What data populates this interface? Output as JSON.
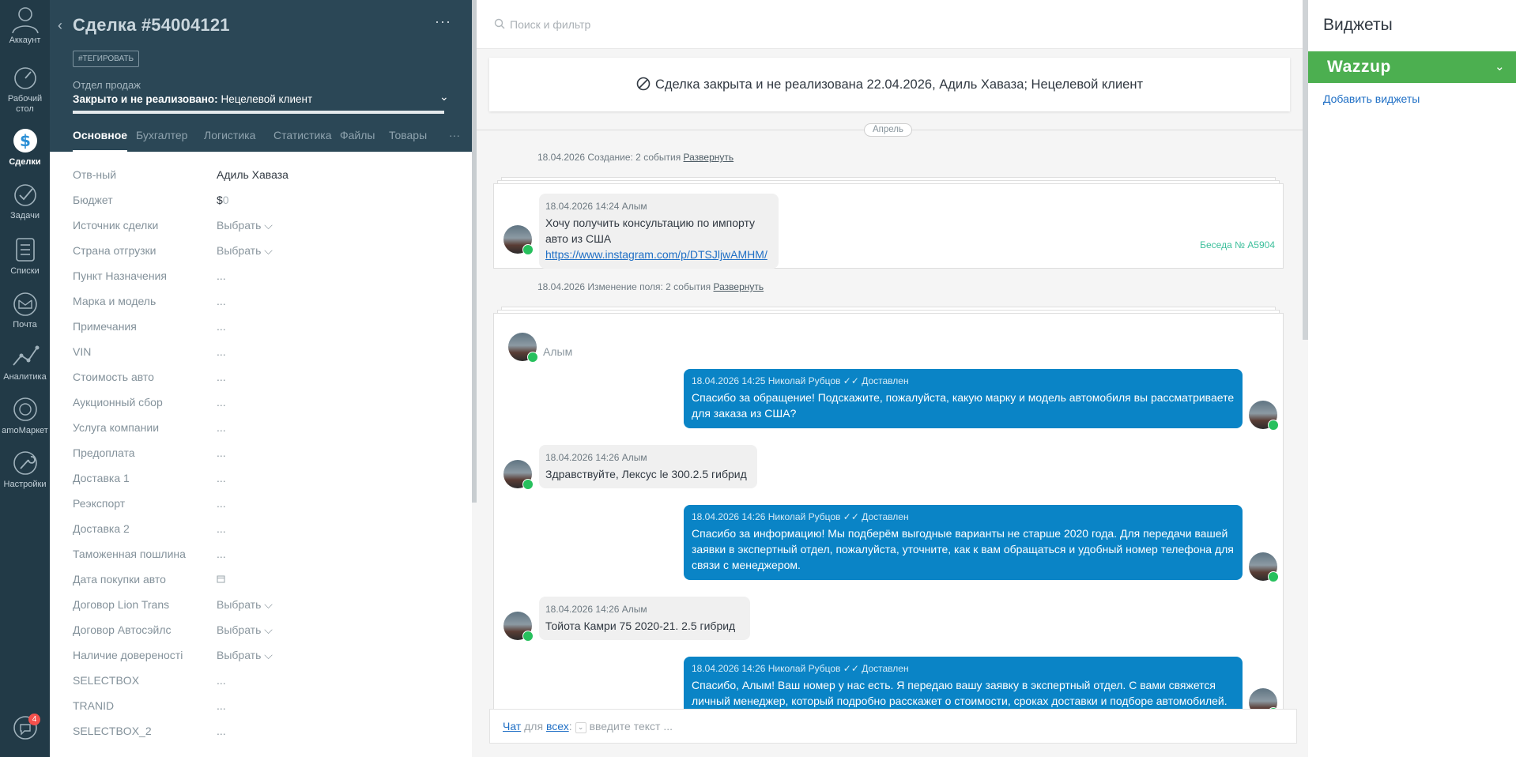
{
  "nav": {
    "account": "Аккаунт",
    "dashboard": "Рабочий стол",
    "deals": "Сделки",
    "tasks": "Задачи",
    "lists": "Списки",
    "mail": "Почта",
    "analytics": "Аналитика",
    "market": "amoМаркет",
    "settings": "Настройки",
    "notifications_count": "4"
  },
  "card": {
    "title": "Сделка #54004121",
    "more": "···",
    "tag_button": "#ТЕГИРОВАТЬ",
    "pipeline_name": "Отдел продаж",
    "status_bold": "Закрыто и не реализовано:",
    "status_reason": " Нецелевой клиент",
    "tabs": [
      "Основное",
      "Бухгалтер",
      "Логистика",
      "Статистика",
      "Файлы",
      "Товары"
    ],
    "tabs_more": "···",
    "fields": [
      {
        "label": "Отв-ный",
        "value": "Адиль Хаваза"
      },
      {
        "label": "Бюджет",
        "value": ""
      },
      {
        "label": "Источник сделки",
        "value": "Выбрать"
      },
      {
        "label": "Страна отгрузки",
        "value": "Выбрать"
      },
      {
        "label": "Пункт Назначения",
        "value": "..."
      },
      {
        "label": "Марка и модель",
        "value": "..."
      },
      {
        "label": "Примечания",
        "value": "..."
      },
      {
        "label": "VIN",
        "value": "..."
      },
      {
        "label": "Стоимость авто",
        "value": "..."
      },
      {
        "label": "Аукционный сбор",
        "value": "..."
      },
      {
        "label": "Услуга компании",
        "value": "..."
      },
      {
        "label": "Предоплата",
        "value": "..."
      },
      {
        "label": "Доставка 1",
        "value": "..."
      },
      {
        "label": "Реэкспорт",
        "value": "..."
      },
      {
        "label": "Доставка 2",
        "value": "..."
      },
      {
        "label": "Таможенная пошлина",
        "value": "..."
      },
      {
        "label": "Дата покупки авто",
        "value": ""
      },
      {
        "label": "Договор Lion Trans",
        "value": "Выбрать"
      },
      {
        "label": "Договор Автосэйлс",
        "value": "Выбрать"
      },
      {
        "label": "Наличие довереностi",
        "value": "Выбрать"
      },
      {
        "label": "SELECTBOX",
        "value": "..."
      },
      {
        "label": "TRANID",
        "value": "..."
      },
      {
        "label": "SELECTBOX_2",
        "value": "..."
      }
    ],
    "budget_currency": "$",
    "budget_value": "0"
  },
  "feed": {
    "search_placeholder": "Поиск и фильтр",
    "closed_banner": "Сделка закрыта и не реализована 22.04.2026, Адиль Хаваза; Нецелевой клиент",
    "month": "Апрель",
    "group1": {
      "text": "18.04.2026 Создание: 2 события ",
      "link": "Развернуть"
    },
    "group2": {
      "text": "18.04.2026 Изменение поля: 2 события ",
      "link": "Развернуть"
    },
    "first_msg": {
      "meta": "18.04.2026 14:24 Алым",
      "text": "Хочу получить консультацию по импорту авто из США",
      "link": "https://www.instagram.com/p/DTSJljwAMHM/",
      "talk": "Беседа № A5904"
    },
    "chat": {
      "sender": "Алым",
      "messages": [
        {
          "dir": "out",
          "meta": "18.04.2026 14:25 Николай Рубцов  ✓✓ Доставлен",
          "text": "Спасибо за обращение! Подскажите, пожалуйста, какую марку и модель автомобиля вы рассматриваете для заказа из США?"
        },
        {
          "dir": "in",
          "meta": "18.04.2026 14:26 Алым",
          "text": "Здравствуйте, Лексус le 300.2.5 гибрид"
        },
        {
          "dir": "out",
          "meta": "18.04.2026 14:26 Николай Рубцов  ✓✓ Доставлен",
          "text": "Спасибо за информацию! Мы подберём выгодные варианты не старше 2020 года. Для передачи вашей заявки в экспертный отдел, пожалуйста, уточните, как к вам обращаться и удобный номер телефона для связи с менеджером."
        },
        {
          "dir": "in",
          "meta": "18.04.2026 14:26 Алым",
          "text": "Тойота Камри 75 2020-21. 2.5 гибрид"
        },
        {
          "dir": "out",
          "meta": "18.04.2026 14:26 Николай Рубцов  ✓✓ Доставлен",
          "text": "Спасибо, Алым! Ваш номер у нас есть. Я передаю вашу заявку в экспертный отдел. С вами свяжется личный менеджер, который подробно расскажет о стоимости, сроках доставки и подборе автомобилей."
        }
      ]
    },
    "composer": {
      "chat": "Чат",
      "for": " для ",
      "all": "всех",
      "colon": ":",
      "placeholder": "введите текст ..."
    }
  },
  "widgets": {
    "title": "Виджеты",
    "wazzup": "Wazzup",
    "add": "Добавить виджеты"
  },
  "colors": {
    "nav_bg": "#223a47",
    "card_head": "#2b4756",
    "out_bubble": "#0a84c6",
    "wazzup_green": "#4caf50",
    "link": "#1f6fc5"
  }
}
